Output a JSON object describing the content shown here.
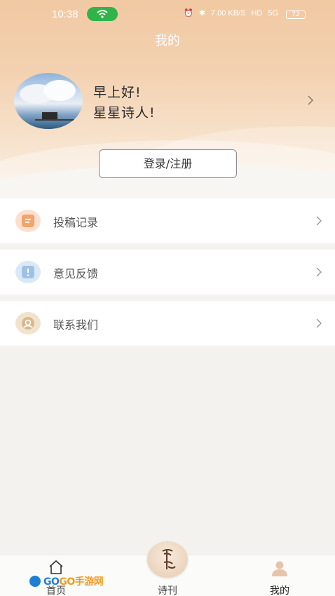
{
  "status_bar": {
    "time": "10:38",
    "speed": "7.00 KB/S",
    "hd": "HD",
    "signal": "5G",
    "battery": "72"
  },
  "header": {
    "title": "我的"
  },
  "profile": {
    "greeting": "早上好!",
    "name": "星星诗人!",
    "avatar_icon": "avatar-photo"
  },
  "login_button": {
    "label": "登录/注册"
  },
  "menu": [
    {
      "label": "投稿记录",
      "icon": "document-icon",
      "color": "#f2a46c"
    },
    {
      "label": "意见反馈",
      "icon": "feedback-icon",
      "color": "#9ec2e6"
    },
    {
      "label": "联系我们",
      "icon": "contact-icon",
      "color": "#d9b98b"
    }
  ],
  "tabbar": {
    "tabs": [
      {
        "label": "首页",
        "icon": "home-icon"
      },
      {
        "label": "诗刊",
        "icon": "poem-icon"
      },
      {
        "label": "我的",
        "icon": "user-icon",
        "active": true
      }
    ]
  },
  "watermark": {
    "prefix": "GO",
    "suffix": "GO手游网"
  },
  "colors": {
    "accent": "#f1c9a3",
    "background": "#f3f2ee",
    "status_green": "#2fb44a"
  }
}
